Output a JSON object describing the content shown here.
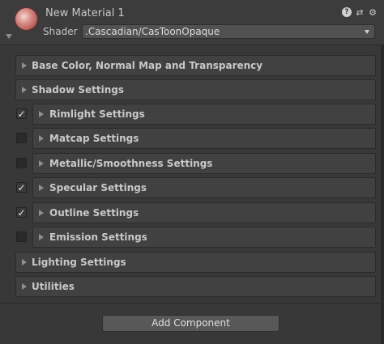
{
  "header": {
    "title": "New Material 1",
    "shader_label": "Shader",
    "shader_value": ".Cascadian/CasToonOpaque",
    "icons": [
      "help-icon",
      "presets-icon",
      "gear-icon"
    ]
  },
  "sections": [
    {
      "label": "Base Color, Normal Map and Transparency",
      "has_toggle": false
    },
    {
      "label": "Shadow Settings",
      "has_toggle": false
    },
    {
      "label": "Rimlight Settings",
      "has_toggle": true,
      "checked": true
    },
    {
      "label": "Matcap Settings",
      "has_toggle": true,
      "checked": false
    },
    {
      "label": "Metallic/Smoothness Settings",
      "has_toggle": true,
      "checked": false
    },
    {
      "label": "Specular Settings",
      "has_toggle": true,
      "checked": true
    },
    {
      "label": "Outline Settings",
      "has_toggle": true,
      "checked": true
    },
    {
      "label": "Emission Settings",
      "has_toggle": true,
      "checked": false
    },
    {
      "label": "Lighting Settings",
      "has_toggle": false
    },
    {
      "label": "Utilities",
      "has_toggle": false
    }
  ],
  "checkmark": "✓",
  "footer": {
    "add_component_label": "Add Component"
  }
}
